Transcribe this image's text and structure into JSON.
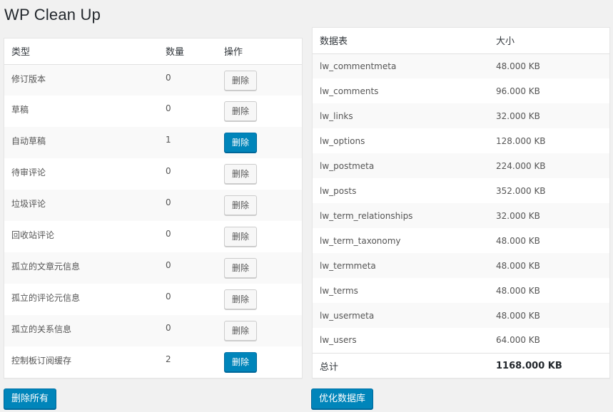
{
  "page": {
    "title": "WP Clean Up"
  },
  "cleanup": {
    "headers": {
      "type": "类型",
      "count": "数量",
      "action": "操作"
    },
    "rows": [
      {
        "type": "修订版本",
        "count": "0",
        "action": "删除",
        "active": false
      },
      {
        "type": "草稿",
        "count": "0",
        "action": "删除",
        "active": false
      },
      {
        "type": "自动草稿",
        "count": "1",
        "action": "删除",
        "active": true
      },
      {
        "type": "待审评论",
        "count": "0",
        "action": "删除",
        "active": false
      },
      {
        "type": "垃圾评论",
        "count": "0",
        "action": "删除",
        "active": false
      },
      {
        "type": "回收站评论",
        "count": "0",
        "action": "删除",
        "active": false
      },
      {
        "type": "孤立的文章元信息",
        "count": "0",
        "action": "删除",
        "active": false
      },
      {
        "type": "孤立的评论元信息",
        "count": "0",
        "action": "删除",
        "active": false
      },
      {
        "type": "孤立的关系信息",
        "count": "0",
        "action": "删除",
        "active": false
      },
      {
        "type": "控制板订阅缓存",
        "count": "2",
        "action": "删除",
        "active": true
      }
    ],
    "delete_all_label": "删除所有"
  },
  "tables": {
    "headers": {
      "name": "数据表",
      "size": "大小"
    },
    "rows": [
      {
        "name": "lw_commentmeta",
        "size": "48.000 KB"
      },
      {
        "name": "lw_comments",
        "size": "96.000 KB"
      },
      {
        "name": "lw_links",
        "size": "32.000 KB"
      },
      {
        "name": "lw_options",
        "size": "128.000 KB"
      },
      {
        "name": "lw_postmeta",
        "size": "224.000 KB"
      },
      {
        "name": "lw_posts",
        "size": "352.000 KB"
      },
      {
        "name": "lw_term_relationships",
        "size": "32.000 KB"
      },
      {
        "name": "lw_term_taxonomy",
        "size": "48.000 KB"
      },
      {
        "name": "lw_termmeta",
        "size": "48.000 KB"
      },
      {
        "name": "lw_terms",
        "size": "48.000 KB"
      },
      {
        "name": "lw_usermeta",
        "size": "48.000 KB"
      },
      {
        "name": "lw_users",
        "size": "64.000 KB"
      }
    ],
    "total_label": "总计",
    "total_size": "1168.000 KB",
    "optimize_label": "优化数据库"
  },
  "colors": {
    "primary": "#0085ba",
    "background": "#f1f1f1"
  }
}
